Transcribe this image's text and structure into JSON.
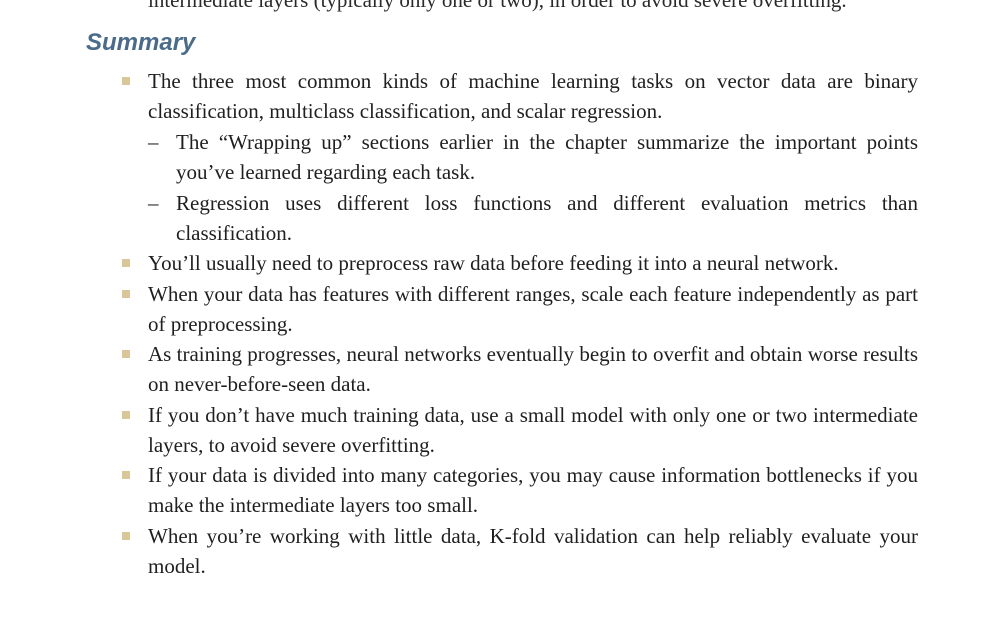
{
  "top_fragment": "intermediate layers (typically only one or two), in order to avoid severe overfitting.",
  "section": {
    "heading": "Summary",
    "items": [
      {
        "text": "The three most common kinds of machine learning tasks on vector data are binary classification, multiclass classification, and scalar regression.",
        "subitems": [
          "The “Wrapping up” sections earlier in the chapter summarize the important points you’ve learned regarding each task.",
          "Regression uses different loss functions and different evaluation metrics than classification."
        ]
      },
      {
        "text": "You’ll usually need to preprocess raw data before feeding it into a neural network."
      },
      {
        "text": "When your data has features with different ranges, scale each feature inde­pendently as part of preprocessing."
      },
      {
        "text": "As training progresses, neural networks eventually begin to overfit and obtain worse results on never-before-seen data."
      },
      {
        "text": "If you don’t have much training data, use a small model with only one or two intermediate layers, to avoid severe overfitting."
      },
      {
        "text": "If your data is divided into many categories, you may cause information bottle­necks if you make the intermediate layers too small."
      },
      {
        "text": "When you’re working with little data, K-fold validation can help reliably evalu­ate your model."
      }
    ]
  },
  "bullet_marker": "■",
  "sub_marker": "–",
  "colors": {
    "heading": "#4a6b8a",
    "bullet": "#d9c79a",
    "text": "#1f1f1f"
  }
}
